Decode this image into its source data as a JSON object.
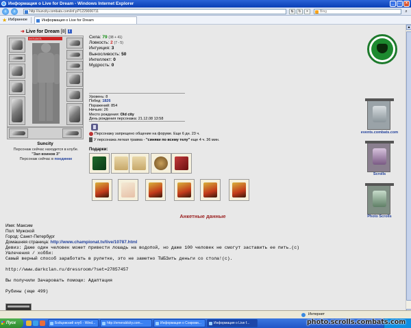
{
  "window": {
    "title": "Информация о Live for Dream - Windows Internet Explorer",
    "url": "http://suncity.combats.com/inf.pl?1229006711",
    "search_placeholder": "Bing",
    "favorites_label": "Избранное",
    "tab_title": "Информация о Live for Dream"
  },
  "character": {
    "name": "Live for Dream",
    "level": "[8]",
    "hp": "2471/2471",
    "hp_fraction": 1.0,
    "city": "Suncity",
    "club_line1": "Персонаж сейчас находится в клубе.",
    "club_room": "\"Зал воинов 3\"",
    "status_prefix": "Персонаж сейчас в",
    "status_place": "поединке"
  },
  "stats": [
    {
      "label": "Сила:",
      "value": "79",
      "extra": "(38 + 41)",
      "color": "#0b8a0b"
    },
    {
      "label": "Ловкость:",
      "value": "2",
      "extra": "(7 - 5)",
      "color": "#c22222"
    },
    {
      "label": "Интуиция:",
      "value": "3",
      "extra": "",
      "color": "#000000"
    },
    {
      "label": "Выносливость:",
      "value": "50",
      "extra": "",
      "color": "#000000"
    },
    {
      "label": "Интеллект:",
      "value": "0",
      "extra": "",
      "color": "#000000"
    },
    {
      "label": "Мудрость:",
      "value": "0",
      "extra": "",
      "color": "#000000"
    }
  ],
  "info": {
    "level_line": "Уровень: 8",
    "wins_label": "Побед:",
    "wins_value": "1826",
    "losses_line": "Поражений: 854",
    "draws_line": "Ничьих: 26",
    "birthplace_label": "Место рождения:",
    "birthplace_value": "Old city",
    "birthday_line": "День рождения персонажа: 21.12.08 13:58"
  },
  "notes": {
    "forum_ban": "Персонажу запрещено общение на форуме. Еще 6 дн. 23 ч.",
    "trauma_prefix": "У персонажа легкая травма -",
    "trauma_name": "\"синяки по всему телу\"",
    "trauma_suffix": "еще 4 ч. 36 мин."
  },
  "gifts_label": "Подарки:",
  "sidebar": {
    "events": "events.combats.com",
    "scrolls": "Scrolls",
    "photo_scrolls": "Photo Scrolls"
  },
  "profile": {
    "title": "Анкетные данные",
    "name": "Имя: Максим",
    "sex": "Пол: Мужской",
    "city": "Город: Санкт-Петербург",
    "homepage_label": "Домашняя страница:",
    "homepage_url": "http://www.championat.tv/live/10787.html",
    "motto": "Девиз: Даже один человек может привести лошадь на водопой, но даже 100 человек не смогут заставить ее пить.(c)",
    "hobby_label": "Увлечения / хобби:",
    "hobby": "Самый верный способ заработать в рулетке, это не заметно ТЫБЗить деньги со стола!(c).",
    "dressroom": "http://www.darkclan.ru/dressroom/?set=27857457",
    "received": "Вы получили Зачаровать помощи: Адаптация",
    "rubies": "Рубины (еще 499)"
  },
  "statusbar": {
    "zone": "Интернет"
  },
  "taskbar": {
    "start": "Пуск",
    "tasks": [
      "Бойцовский клуб - Wind...",
      "http://emeraldcity.com...",
      "Информация о Сокрови...",
      "Информация о Live f..."
    ]
  },
  "watermark": "photo.scrolls.combats.com"
}
